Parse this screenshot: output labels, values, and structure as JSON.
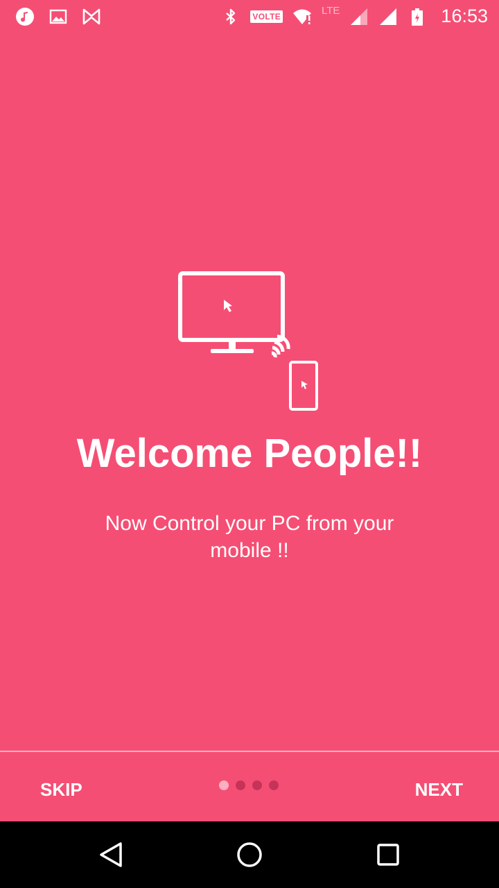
{
  "status_bar": {
    "left_icons": [
      "music-icon",
      "image-icon",
      "app-icon"
    ],
    "right_icons": [
      "bluetooth-icon",
      "volte-badge",
      "wifi-icon",
      "lte-indicator",
      "signal-icon",
      "signal-icon-2",
      "battery-icon"
    ],
    "volte_label": "VOLTE",
    "lte_label": "LTE",
    "time": "16:53"
  },
  "onboarding": {
    "title": "Welcome People!!",
    "description": "Now Control your PC from your mobile !!",
    "illustration": "pc-phone-remote-icon"
  },
  "footer": {
    "skip_label": "SKIP",
    "next_label": "NEXT",
    "page_count": 4,
    "active_page": 1
  },
  "nav_bar": {
    "back": "back-icon",
    "home": "home-icon",
    "recents": "recents-icon"
  },
  "colors": {
    "background": "#F54E74",
    "text": "#FFFFFF",
    "nav_bar": "#000000"
  }
}
